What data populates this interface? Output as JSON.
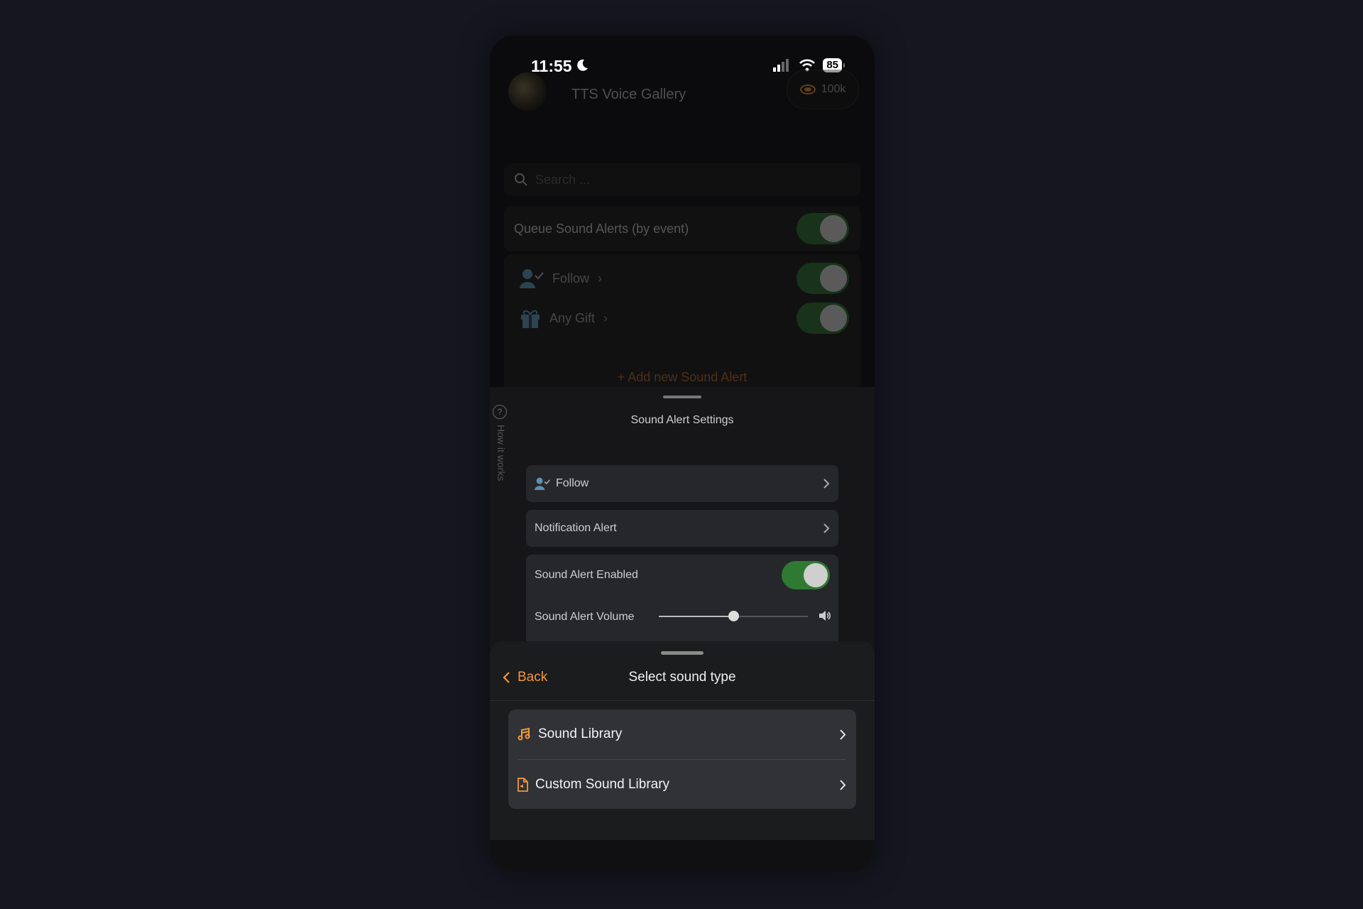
{
  "status_bar": {
    "time": "11:55",
    "battery": "85"
  },
  "header": {
    "title": "TTS Voice Gallery",
    "coins": "100k"
  },
  "search": {
    "placeholder": "Search ..."
  },
  "queue": {
    "label": "Queue Sound Alerts (by event)",
    "enabled": true
  },
  "events": [
    {
      "label": "Follow",
      "enabled": true
    },
    {
      "label": "Any Gift",
      "enabled": true
    }
  ],
  "add_new_label": "+ Add new Sound Alert",
  "side_help": {
    "label": "How it works"
  },
  "settings_sheet": {
    "title": "Sound Alert Settings",
    "event_label": "Follow",
    "alert_type_label": "Notification Alert",
    "enabled_label": "Sound Alert Enabled",
    "enabled": true,
    "volume_label": "Sound Alert Volume",
    "volume": 0.5
  },
  "select_sheet": {
    "back_label": "Back",
    "title": "Select sound type",
    "options": [
      {
        "label": "Sound Library",
        "icon": "music-note-icon"
      },
      {
        "label": "Custom Sound Library",
        "icon": "file-audio-icon"
      }
    ]
  },
  "colors": {
    "accent": "#f0983a",
    "toggle_on": "#2e7a33",
    "background": "#161621"
  }
}
